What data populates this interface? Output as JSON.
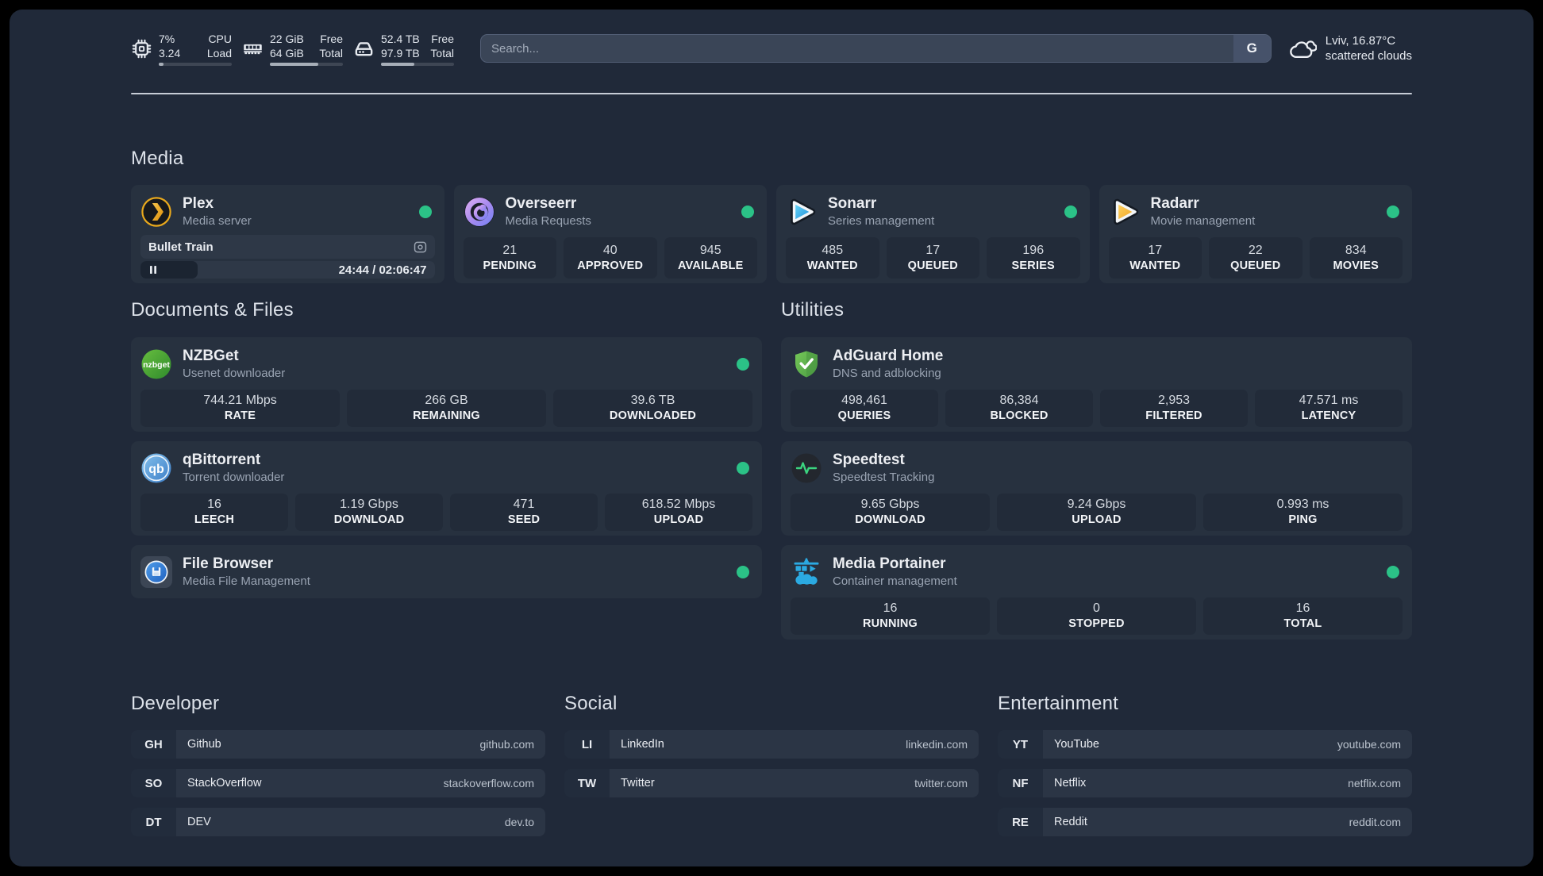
{
  "colors": {
    "status_online": "#2BC287",
    "background": "#202939",
    "card": "#27313F"
  },
  "topbar": {
    "resources": [
      {
        "icon": "cpu-icon",
        "values": [
          "7%",
          "3.24"
        ],
        "labels": [
          "CPU",
          "Load"
        ],
        "progress": "7%"
      },
      {
        "icon": "memory-icon",
        "values": [
          "22 GiB",
          "64 GiB"
        ],
        "labels": [
          "Free",
          "Total"
        ],
        "progress": "66%"
      },
      {
        "icon": "disk-icon",
        "values": [
          "52.4 TB",
          "97.9 TB"
        ],
        "labels": [
          "Free",
          "Total"
        ],
        "progress": "46%"
      }
    ],
    "search": {
      "placeholder": "Search...",
      "button_label": "G"
    },
    "weather": {
      "location_temp": "Lviv, 16.87°C",
      "condition": "scattered clouds"
    }
  },
  "media": {
    "title": "Media",
    "cards": [
      {
        "name": "Plex",
        "desc": "Media server",
        "online": true,
        "now_playing": {
          "title": "Bullet Train",
          "time": "24:44 / 02:06:47",
          "progress": "19.5%"
        }
      },
      {
        "name": "Overseerr",
        "desc": "Media Requests",
        "online": true,
        "stats": [
          {
            "value": "21",
            "label": "PENDING"
          },
          {
            "value": "40",
            "label": "APPROVED"
          },
          {
            "value": "945",
            "label": "AVAILABLE"
          }
        ]
      },
      {
        "name": "Sonarr",
        "desc": "Series management",
        "online": true,
        "stats": [
          {
            "value": "485",
            "label": "WANTED"
          },
          {
            "value": "17",
            "label": "QUEUED"
          },
          {
            "value": "196",
            "label": "SERIES"
          }
        ]
      },
      {
        "name": "Radarr",
        "desc": "Movie management",
        "online": true,
        "stats": [
          {
            "value": "17",
            "label": "WANTED"
          },
          {
            "value": "22",
            "label": "QUEUED"
          },
          {
            "value": "834",
            "label": "MOVIES"
          }
        ]
      }
    ]
  },
  "documents": {
    "title": "Documents & Files",
    "cards": [
      {
        "name": "NZBGet",
        "desc": "Usenet downloader",
        "online": true,
        "stats": [
          {
            "value": "744.21 Mbps",
            "label": "RATE"
          },
          {
            "value": "266 GB",
            "label": "REMAINING"
          },
          {
            "value": "39.6 TB",
            "label": "DOWNLOADED"
          }
        ]
      },
      {
        "name": "qBittorrent",
        "desc": "Torrent downloader",
        "online": true,
        "stats": [
          {
            "value": "16",
            "label": "LEECH"
          },
          {
            "value": "1.19 Gbps",
            "label": "DOWNLOAD"
          },
          {
            "value": "471",
            "label": "SEED"
          },
          {
            "value": "618.52 Mbps",
            "label": "UPLOAD"
          }
        ]
      },
      {
        "name": "File Browser",
        "desc": "Media File Management",
        "online": true
      }
    ]
  },
  "utilities": {
    "title": "Utilities",
    "cards": [
      {
        "name": "AdGuard Home",
        "desc": "DNS and adblocking",
        "online": false,
        "stats": [
          {
            "value": "498,461",
            "label": "QUERIES"
          },
          {
            "value": "86,384",
            "label": "BLOCKED"
          },
          {
            "value": "2,953",
            "label": "FILTERED"
          },
          {
            "value": "47.571 ms",
            "label": "LATENCY"
          }
        ]
      },
      {
        "name": "Speedtest",
        "desc": "Speedtest Tracking",
        "online": false,
        "stats": [
          {
            "value": "9.65 Gbps",
            "label": "DOWNLOAD"
          },
          {
            "value": "9.24 Gbps",
            "label": "UPLOAD"
          },
          {
            "value": "0.993 ms",
            "label": "PING"
          }
        ]
      },
      {
        "name": "Media Portainer",
        "desc": "Container management",
        "online": true,
        "stats": [
          {
            "value": "16",
            "label": "RUNNING"
          },
          {
            "value": "0",
            "label": "STOPPED"
          },
          {
            "value": "16",
            "label": "TOTAL"
          }
        ]
      }
    ]
  },
  "bookmarks": {
    "groups": [
      {
        "title": "Developer",
        "items": [
          {
            "abbr": "GH",
            "name": "Github",
            "url": "github.com"
          },
          {
            "abbr": "SO",
            "name": "StackOverflow",
            "url": "stackoverflow.com"
          },
          {
            "abbr": "DT",
            "name": "DEV",
            "url": "dev.to"
          }
        ]
      },
      {
        "title": "Social",
        "items": [
          {
            "abbr": "LI",
            "name": "LinkedIn",
            "url": "linkedin.com"
          },
          {
            "abbr": "TW",
            "name": "Twitter",
            "url": "twitter.com"
          }
        ]
      },
      {
        "title": "Entertainment",
        "items": [
          {
            "abbr": "YT",
            "name": "YouTube",
            "url": "youtube.com"
          },
          {
            "abbr": "NF",
            "name": "Netflix",
            "url": "netflix.com"
          },
          {
            "abbr": "RE",
            "name": "Reddit",
            "url": "reddit.com"
          }
        ]
      }
    ]
  }
}
